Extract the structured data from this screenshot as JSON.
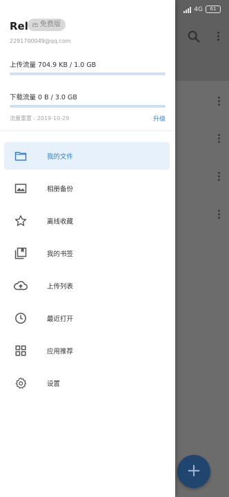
{
  "status_bar": {
    "network": "4G",
    "battery": "61"
  },
  "background_app": {
    "search_icon": "search-icon",
    "more_icon": "more-vertical-icon",
    "fab_label": "+"
  },
  "drawer": {
    "user": {
      "name": "Rel",
      "plan_badge": "免费版",
      "email": "2291700049@qq.com"
    },
    "traffic": {
      "upload_label": "上传流量 704.9 KB / 1.0 GB",
      "upload_progress": 0.0007,
      "download_label": "下载流量 0 B / 3.0 GB",
      "download_progress": 0.0,
      "reset_label": "流量重置 : 2019-10-29",
      "upgrade_label": "升级"
    },
    "menu": [
      {
        "label": "我的文件",
        "icon": "folder-icon",
        "active": true
      },
      {
        "label": "相册备份",
        "icon": "image-icon",
        "active": false
      },
      {
        "label": "离线收藏",
        "icon": "star-icon",
        "active": false
      },
      {
        "label": "我的书签",
        "icon": "bookmark-icon",
        "active": false
      },
      {
        "label": "上传列表",
        "icon": "cloud-upload-icon",
        "active": false
      },
      {
        "label": "最近打开",
        "icon": "clock-icon",
        "active": false
      },
      {
        "label": "应用推荐",
        "icon": "apps-icon",
        "active": false
      },
      {
        "label": "设置",
        "icon": "gear-icon",
        "active": false
      }
    ]
  },
  "colors": {
    "accent": "#3a80c9",
    "active_bg": "#e7f1fb",
    "progress_track": "#cfe0f2",
    "scrim": "#6c6c6c",
    "fab": "#20456e"
  }
}
